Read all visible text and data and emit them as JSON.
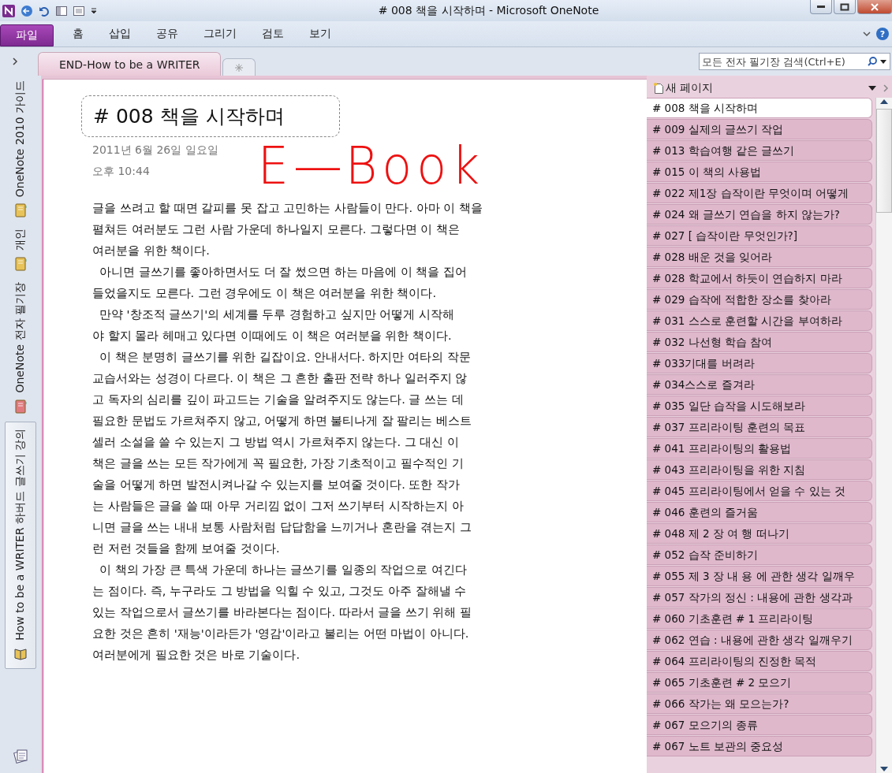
{
  "window": {
    "title": "# 008 책을 시작하며  -  Microsoft OneNote"
  },
  "ribbon": {
    "file_tab": "파일",
    "tabs": [
      "홈",
      "삽입",
      "공유",
      "그리기",
      "검토",
      "보기"
    ],
    "help": "?"
  },
  "section_tabs": [
    {
      "label": "END-How to be a WRITER",
      "selected": true
    }
  ],
  "search": {
    "placeholder": "모든 전자 필기장 검색(Ctrl+E)"
  },
  "notebooks": [
    {
      "label": "OneNote 2010 가이드",
      "kind": "notebook",
      "color": "#e8c35a",
      "selected": false
    },
    {
      "label": "개인",
      "kind": "notebook",
      "color": "#e8c35a",
      "selected": false
    },
    {
      "label": "OneNote 전자 필기장",
      "kind": "notebook",
      "color": "#e07a80",
      "selected": false
    },
    {
      "label": "How to be a WRITER 하버드 글쓰기 강의",
      "kind": "book",
      "color": "#e8c35a",
      "selected": true
    }
  ],
  "page": {
    "title": "# 008 책을 시작하며",
    "date": "2011년 6월 26일 일요일",
    "time": "오후 10:44",
    "ink": "E—Book",
    "paragraphs": [
      {
        "indent": false,
        "lines": [
          "글을 쓰려고 할 때면 갈피를 못 잡고 고민하는 사람들이 만다. 아마 이 책을",
          "펼쳐든 여러분도 그런 사람 가운데 하나일지 모른다. 그렇다면 이 책은",
          "여러분을 위한 책이다."
        ]
      },
      {
        "indent": true,
        "lines": [
          "아니면 글쓰기를 좋아하면서도 더 잘 썼으면 하는 마음에 이 책을 집어",
          "들었을지도 모른다. 그런 경우에도 이 책은 여러분을 위한 책이다."
        ]
      },
      {
        "indent": true,
        "lines": [
          "만약 '창조적 글쓰기'의 세계를 두루 경험하고 싶지만 어떻게 시작해",
          "야 할지 몰라 헤매고 있다면 이때에도 이 책은 여러분을 위한 책이다."
        ]
      },
      {
        "indent": true,
        "lines": [
          "이 책은 분명히 글쓰기를 위한 길잡이요. 안내서다. 하지만 여타의 작문",
          "교습서와는 성경이 다르다. 이 책은 그 흔한 출판 전략 하나 일러주지 않",
          "고 독자의 심리를 깊이 파고드는 기술을 알려주지도 않는다. 글 쓰는 데",
          "필요한 문법도 가르쳐주지 않고, 어떻게 하면 불티나게 잘 팔리는 베스트",
          "셀러 소설을 쓸 수 있는지 그 방법 역시 가르쳐주지 않는다. 그 대신 이",
          "책은 글을 쓰는 모든 작가에게 꼭 필요한, 가장 기초적이고 필수적인 기",
          "술을 어떻게 하면 발전시켜나갈 수 있는지를 보여줄 것이다. 또한 작가",
          "는 사람들은 글을 쓸 때 아무 거리낌 없이 그저 쓰기부터 시작하는지 아",
          "니면 글을 쓰는 내내 보통 사람처럼 답답함을 느끼거나 혼란을 겪는지 그",
          "런 저런 것들을 함께 보여줄 것이다."
        ]
      },
      {
        "indent": true,
        "lines": [
          "이 책의 가장 큰 특색 가운데 하나는 글쓰기를 일종의 작업으로 여긴다",
          "는 점이다.  즉, 누구라도 그 방법을 익힐 수 있고, 그것도 아주 잘해낼 수",
          "있는 작업으로서 글쓰기를 바라본다는 점이다. 따라서 글을 쓰기 위해 필",
          "요한 것은 흔히 '재능'이라든가 '영감'이라고 불리는 어떤 마법이 아니다.",
          "여러분에게 필요한 것은 바로 기술이다."
        ]
      }
    ]
  },
  "page_list": {
    "new_page": "새 페이지",
    "pages": [
      {
        "label": "# 008 책을 시작하며",
        "selected": true
      },
      {
        "label": "# 009 실제의 글쓰기 작업",
        "selected": false
      },
      {
        "label": "# 013 학습여행 같은 글쓰기",
        "selected": false
      },
      {
        "label": "# 015 이 책의 사용법",
        "selected": false
      },
      {
        "label": "# 022 제1장 습작이란 무엇이며 어떻게",
        "selected": false
      },
      {
        "label": "# 024 왜 글쓰기 연습을 하지 않는가?",
        "selected": false
      },
      {
        "label": "# 027 [ 습작이란 무엇인가?]",
        "selected": false
      },
      {
        "label": "# 028 배운 것을 잊어라",
        "selected": false
      },
      {
        "label": "# 028 학교에서 하듯이 연습하지 마라",
        "selected": false
      },
      {
        "label": "# 029 습작에 적합한 장소를 찾아라",
        "selected": false
      },
      {
        "label": "# 031 스스로 훈련할 시간을 부여하라",
        "selected": false
      },
      {
        "label": "# 032 나선형 학습 참여",
        "selected": false
      },
      {
        "label": "# 033기대를 버려라",
        "selected": false
      },
      {
        "label": "# 034스스로 즐겨라",
        "selected": false
      },
      {
        "label": "# 035 일단 습작을 시도해보라",
        "selected": false
      },
      {
        "label": "# 037 프리라이팅 훈련의 목표",
        "selected": false
      },
      {
        "label": "# 041 프리라이팅의 활용법",
        "selected": false
      },
      {
        "label": "# 043 프리라이팅을 위한 지침",
        "selected": false
      },
      {
        "label": "# 045 프리라이팅에서 얻을 수 있는 것",
        "selected": false
      },
      {
        "label": "# 046 훈련의 즐거움",
        "selected": false
      },
      {
        "label": "# 048 제  2  장 여 행 떠나기",
        "selected": false
      },
      {
        "label": "# 052 습작 준비하기",
        "selected": false
      },
      {
        "label": "# 055 제 3 장 내 용 에 관한 생각 일깨우",
        "selected": false
      },
      {
        "label": "# 057 작가의 정신 : 내용에 관한 생각과",
        "selected": false
      },
      {
        "label": "# 060 기초훈련  #   1   프리라이팅",
        "selected": false
      },
      {
        "label": "# 062 연습 : 내용에 관한 생각 일깨우기",
        "selected": false
      },
      {
        "label": "# 064 프리라이팅의 진정한 목적",
        "selected": false
      },
      {
        "label": "# 065 기초훈련  #    2  모으기",
        "selected": false
      },
      {
        "label": "# 066 작가는 왜 모으는가?",
        "selected": false
      },
      {
        "label": "# 067 모으기의 종류",
        "selected": false
      },
      {
        "label": "# 067 노트 보관의 중요성",
        "selected": false
      }
    ]
  }
}
